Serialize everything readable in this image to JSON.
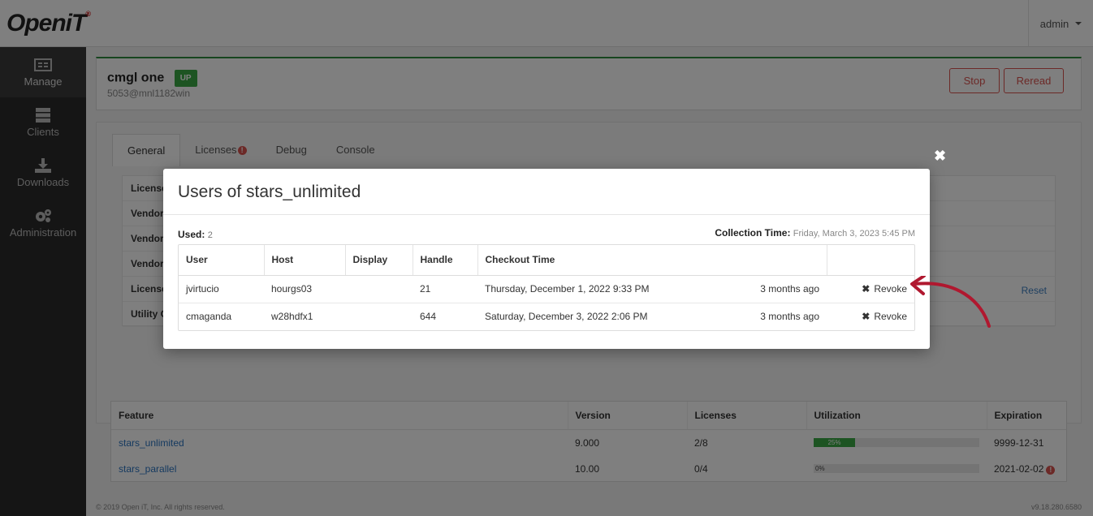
{
  "header": {
    "logo": "OpenIT",
    "user": "admin"
  },
  "sidebar": {
    "items": [
      {
        "label": "Manage",
        "icon": "manage-icon"
      },
      {
        "label": "Clients",
        "icon": "clients-icon"
      },
      {
        "label": "Downloads",
        "icon": "download-icon"
      },
      {
        "label": "Administration",
        "icon": "gears-icon"
      }
    ]
  },
  "server": {
    "name": "cmgl one",
    "status": "UP",
    "address": "5053@mnl1182win",
    "stop_label": "Stop",
    "reread_label": "Reread"
  },
  "tabs": [
    "General",
    "Licenses",
    "Debug",
    "Console"
  ],
  "general_rows": [
    "License",
    "Vendor",
    "Vendor",
    "Vendor",
    "License",
    "Utility C"
  ],
  "reset_label": "Reset",
  "features": {
    "headers": [
      "Feature",
      "Version",
      "Licenses",
      "Utilization",
      "Expiration"
    ],
    "rows": [
      {
        "feature": "stars_unlimited",
        "version": "9.000",
        "licenses": "2/8",
        "utilization": "25%",
        "util_value": 0.25,
        "expiration": "9999-12-31"
      },
      {
        "feature": "stars_parallel",
        "version": "10.00",
        "licenses": "0/4",
        "utilization": "0%",
        "util_value": 0.0,
        "expiration": "2021-02-02"
      }
    ]
  },
  "footer": {
    "copyright": "© 2019 Open iT, Inc. All rights reserved.",
    "version": "v9.18.280.6580"
  },
  "modal": {
    "title": "Users of stars_unlimited",
    "used_label": "Used:",
    "used_value": "2",
    "collection_label": "Collection Time:",
    "collection_value": "Friday, March 3, 2023 5:45 PM",
    "headers": [
      "User",
      "Host",
      "Display",
      "Handle",
      "Checkout Time"
    ],
    "rows": [
      {
        "user": "jvirtucio",
        "host": "hourgs03",
        "display": "",
        "handle": "21",
        "checkout": "Thursday, December 1, 2022 9:33 PM",
        "ago": "3 months ago",
        "action": "Revoke"
      },
      {
        "user": "cmaganda",
        "host": "w28hdfx1",
        "display": "",
        "handle": "644",
        "checkout": "Saturday, December 3, 2022 2:06 PM",
        "ago": "3 months ago",
        "action": "Revoke"
      }
    ]
  },
  "colors": {
    "accent_green": "#3aa845",
    "danger": "#d9534f",
    "link": "#2b74c0",
    "arrow": "#b0182f"
  }
}
